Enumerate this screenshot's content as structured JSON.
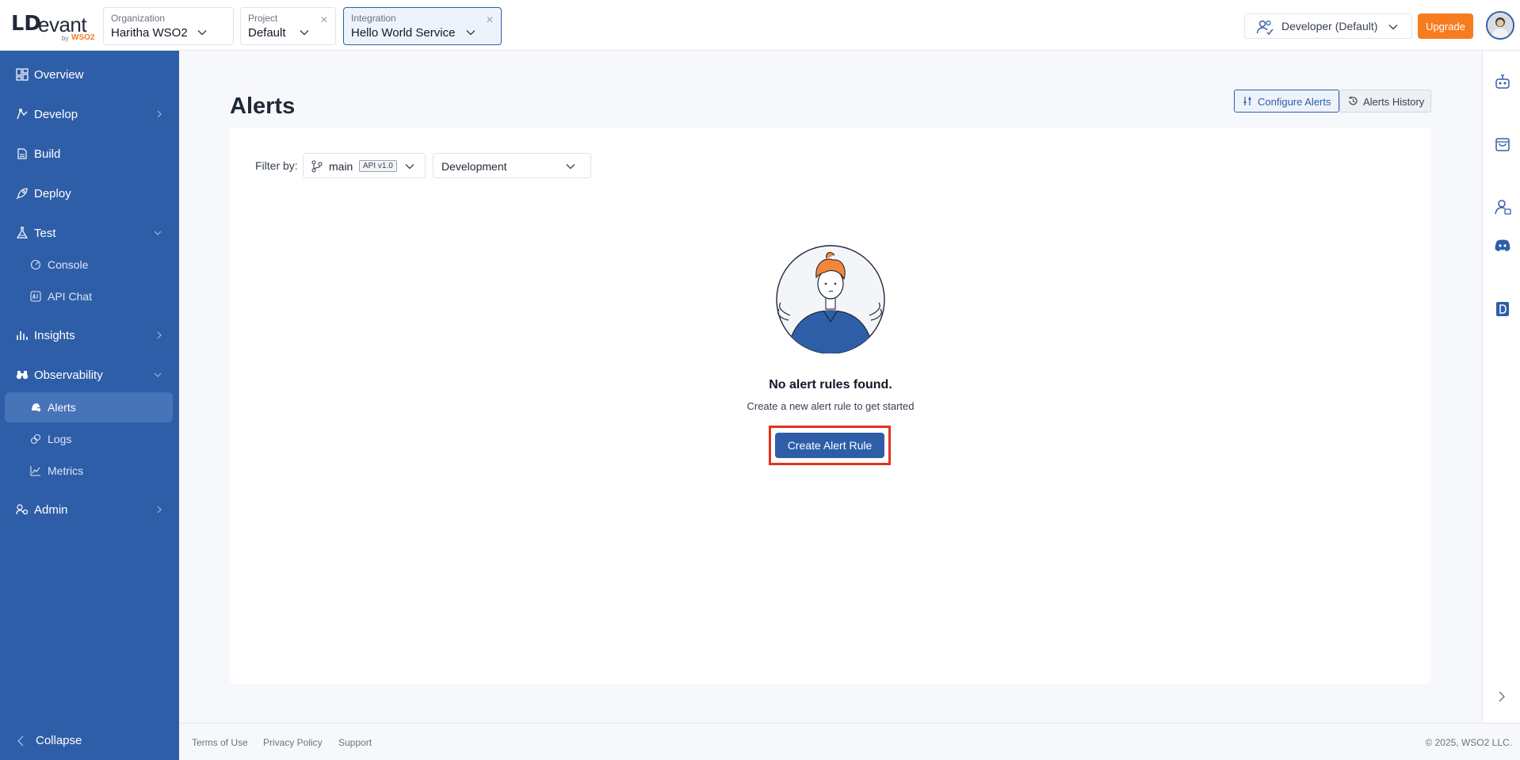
{
  "brand": {
    "mark": "ᒪD",
    "word": "evant",
    "by": "by",
    "wso2": "WSO2"
  },
  "context": {
    "organization": {
      "label": "Organization",
      "value": "Haritha WSO2"
    },
    "project": {
      "label": "Project",
      "value": "Default"
    },
    "integration": {
      "label": "Integration",
      "value": "Hello World Service"
    }
  },
  "header": {
    "role": "Developer (Default)",
    "upgrade": "Upgrade"
  },
  "sidebar": {
    "items": [
      {
        "label": "Overview",
        "icon": "overview-icon"
      },
      {
        "label": "Develop",
        "icon": "develop-icon"
      },
      {
        "label": "Build",
        "icon": "build-icon"
      },
      {
        "label": "Deploy",
        "icon": "deploy-icon"
      },
      {
        "label": "Test",
        "icon": "flask-icon"
      },
      {
        "label": "Console",
        "icon": "console-icon"
      },
      {
        "label": "API Chat",
        "icon": "ai-chat-icon"
      },
      {
        "label": "Insights",
        "icon": "insights-icon"
      },
      {
        "label": "Observability",
        "icon": "binoculars-icon"
      },
      {
        "label": "Alerts",
        "icon": "alerts-icon"
      },
      {
        "label": "Logs",
        "icon": "logs-icon"
      },
      {
        "label": "Metrics",
        "icon": "metrics-icon"
      },
      {
        "label": "Admin",
        "icon": "admin-icon"
      }
    ],
    "collapse": "Collapse"
  },
  "main": {
    "title": "Alerts",
    "tabs": {
      "configure": "Configure Alerts",
      "history": "Alerts History"
    },
    "filter": {
      "label": "Filter by:",
      "branch": "main",
      "version": "API v1.0",
      "environment": "Development"
    },
    "empty": {
      "title": "No alert rules found.",
      "subtitle": "Create a new alert rule to get started",
      "cta": "Create Alert Rule"
    }
  },
  "footer": {
    "links": [
      "Terms of Use",
      "Privacy Policy",
      "Support"
    ],
    "copyright": "© 2025, WSO2 LLC."
  },
  "colors": {
    "primary": "#2f5ea8",
    "accent": "#f57c1f",
    "highlight": "#e6321e"
  }
}
